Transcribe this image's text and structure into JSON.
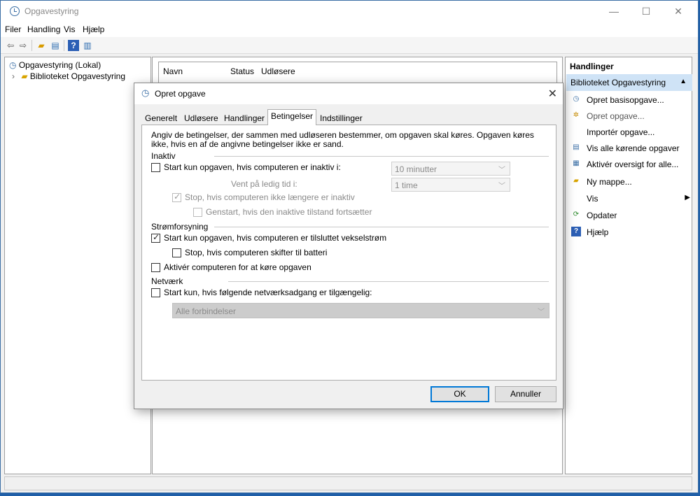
{
  "window": {
    "title": "Opgavestyring",
    "controls": {
      "minimize": "—",
      "maximize": "☐",
      "close": "✕"
    }
  },
  "menu": [
    "Filer",
    "Handling",
    "Vis",
    "Hjælp"
  ],
  "tree": {
    "root": "Opgavestyring (Lokal)",
    "child": "Biblioteket Opgavestyring"
  },
  "center": {
    "columns": [
      "Navn",
      "Status",
      "Udløsere"
    ]
  },
  "actions": {
    "title": "Handlinger",
    "section": "Biblioteket Opgavestyring",
    "items": [
      {
        "label": "Opret basisopgave...",
        "icon": "clock-icon"
      },
      {
        "label": "Opret opgave...",
        "icon": "new-task-icon"
      },
      {
        "label": "Importér opgave...",
        "icon": ""
      },
      {
        "label": "Vis alle kørende opgaver",
        "icon": "list-icon"
      },
      {
        "label": "Aktivér oversigt for alle...",
        "icon": "history-icon"
      },
      {
        "label": "Ny mappe...",
        "icon": "folder-icon"
      },
      {
        "label": "Vis",
        "icon": ""
      },
      {
        "label": "Opdater",
        "icon": "refresh-icon"
      },
      {
        "label": "Hjælp",
        "icon": "help-icon"
      }
    ]
  },
  "dialog": {
    "title": "Opret opgave",
    "tabs": [
      "Generelt",
      "Udløsere",
      "Handlinger",
      "Betingelser",
      "Indstillinger"
    ],
    "active_tab": "Betingelser",
    "description": "Angiv de betingelser, der sammen med udløseren bestemmer, om opgaven skal køres. Opgaven køres ikke, hvis en af de angivne betingelser ikke er sand.",
    "idle": {
      "label": "Inaktiv",
      "start_if_idle": {
        "label": "Start kun opgaven, hvis computeren er inaktiv i:",
        "checked": false
      },
      "idle_duration": "10 minutter",
      "wait_label": "Vent på ledig tid i:",
      "wait_duration": "1 time",
      "stop_if_not_idle": {
        "label": "Stop, hvis computeren ikke længere er inaktiv",
        "checked": true,
        "enabled": false
      },
      "restart_if_idle": {
        "label": "Genstart, hvis den inaktive tilstand fortsætter",
        "checked": false,
        "enabled": false
      }
    },
    "power": {
      "label": "Strømforsyning",
      "ac_only": {
        "label": "Start kun opgaven, hvis computeren er tilsluttet vekselstrøm",
        "checked": true
      },
      "stop_on_battery": {
        "label": "Stop, hvis computeren skifter til batteri",
        "checked": false
      },
      "wake": {
        "label": "Aktivér computeren for at køre opgaven",
        "checked": false
      }
    },
    "network": {
      "label": "Netværk",
      "start_if_network": {
        "label": "Start kun, hvis følgende netværksadgang er tilgængelig:",
        "checked": false
      },
      "connection": "Alle forbindelser"
    },
    "buttons": {
      "ok": "OK",
      "cancel": "Annuller"
    }
  }
}
